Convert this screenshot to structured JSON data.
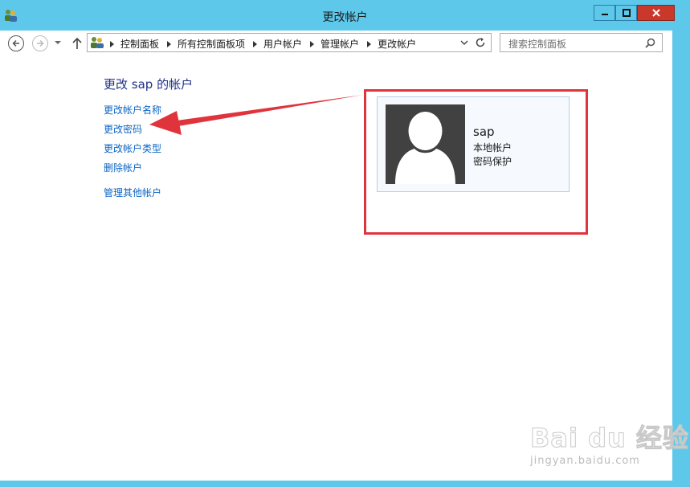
{
  "window": {
    "title": "更改帐户",
    "minimize_icon": "minimize-icon",
    "maximize_icon": "maximize-icon",
    "close_icon": "close-icon"
  },
  "nav": {
    "breadcrumbs": [
      "控制面板",
      "所有控制面板项",
      "用户帐户",
      "管理帐户",
      "更改帐户"
    ],
    "search_placeholder": "搜索控制面板"
  },
  "main": {
    "heading": "更改 sap 的帐户",
    "tasks": [
      {
        "label": "更改帐户名称"
      },
      {
        "label": "更改密码"
      },
      {
        "label": "更改帐户类型"
      },
      {
        "label": "删除帐户"
      }
    ],
    "manage_other": "管理其他帐户"
  },
  "account": {
    "name": "sap",
    "type": "本地帐户",
    "protection": "密码保护"
  },
  "watermark": {
    "brand": "Bai du 经验",
    "url": "jingyan.baidu.com"
  },
  "colors": {
    "frame": "#5ec8ea",
    "link": "#0e66c4",
    "heading": "#1e3287",
    "highlight": "#e0343c",
    "close_button": "#c9382a"
  }
}
